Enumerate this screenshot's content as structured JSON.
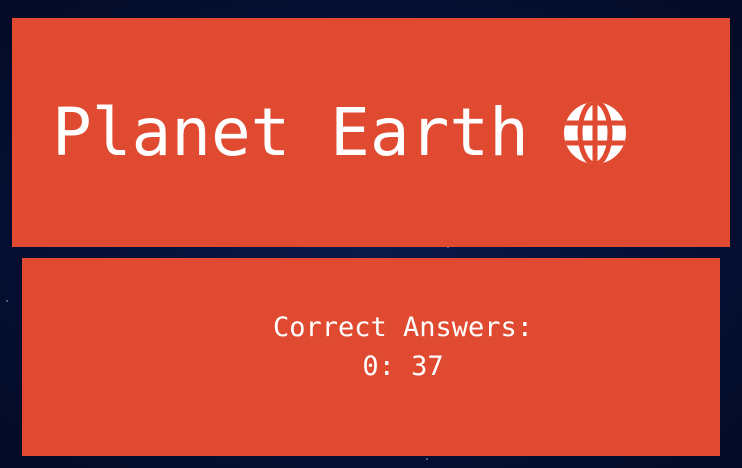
{
  "title": {
    "text": "Planet Earth",
    "icon": "globe-icon"
  },
  "score": {
    "label": "Correct Answers:",
    "value": "0: 37"
  },
  "colors": {
    "card": "#e04a30",
    "background": "#061036",
    "text": "#ffffff"
  }
}
